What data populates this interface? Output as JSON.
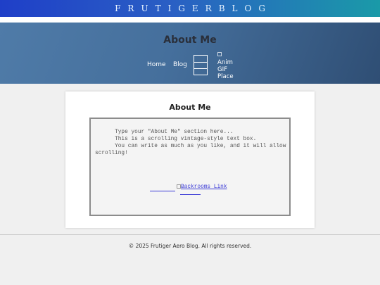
{
  "banner": {
    "title": "FRUTIGERBLOG"
  },
  "header": {
    "title": "About Me",
    "nav": [
      {
        "label": "Home"
      },
      {
        "label": "Blog"
      }
    ],
    "gif_placeholder": "Anim GIF Place"
  },
  "main": {
    "heading": "About Me",
    "textbox": {
      "text": "      Type your \"About Me\" section here...\n      This is a scrolling vintage-style text box.\n      You can write as much as you like, and it will allow scrolling!"
    },
    "image_link_alt": "Backrooms Link"
  },
  "footer": {
    "text": "© 2025 Frutiger Aero Blog. All rights reserved."
  },
  "colors": {
    "banner_start": "#1f3fc8",
    "banner_end": "#1a9aa8",
    "header_start": "#4f7ba8",
    "header_end": "#2f4e74",
    "link": "#3a3ad6"
  }
}
